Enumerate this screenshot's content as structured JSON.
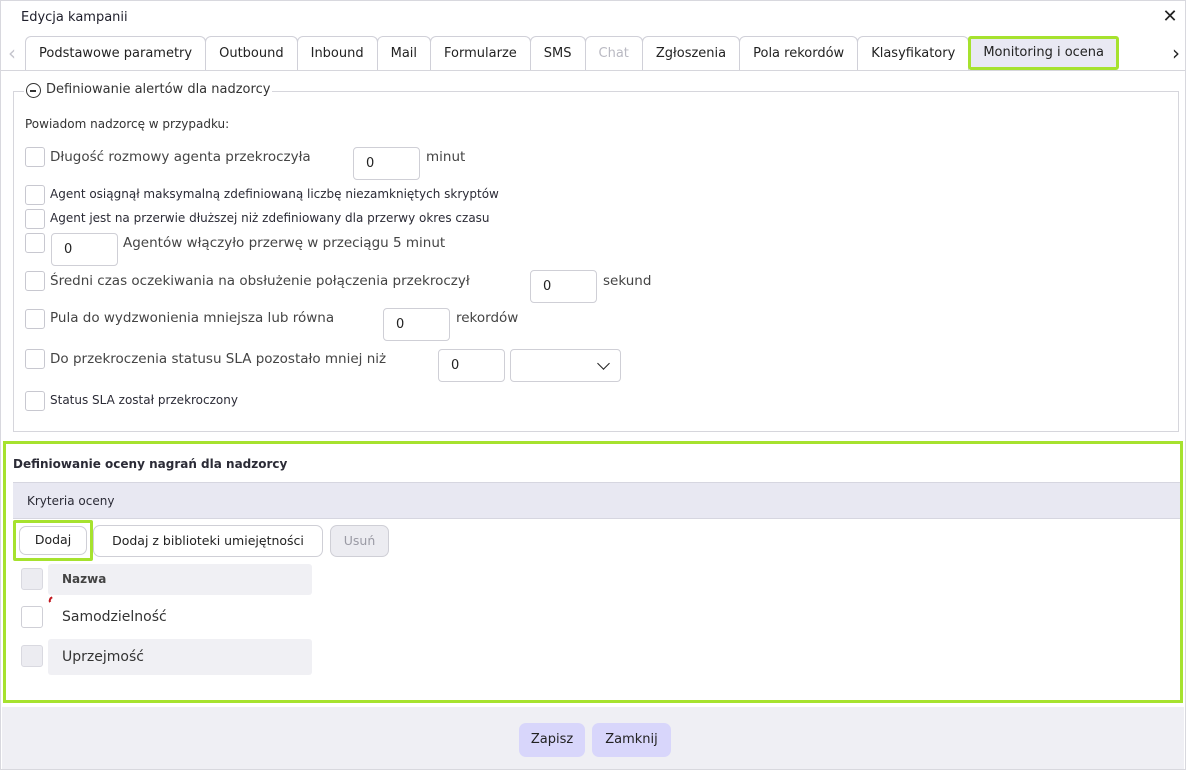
{
  "window": {
    "title": "Edycja kampanii"
  },
  "tabs": [
    {
      "label": "Podstawowe parametry",
      "state": "normal"
    },
    {
      "label": "Outbound",
      "state": "normal"
    },
    {
      "label": "Inbound",
      "state": "normal"
    },
    {
      "label": "Mail",
      "state": "normal"
    },
    {
      "label": "Formularze",
      "state": "normal"
    },
    {
      "label": "SMS",
      "state": "normal"
    },
    {
      "label": "Chat",
      "state": "disabled"
    },
    {
      "label": "Zgłoszenia",
      "state": "normal"
    },
    {
      "label": "Pola rekordów",
      "state": "normal"
    },
    {
      "label": "Klasyfikatory",
      "state": "normal"
    },
    {
      "label": "Monitoring i ocena",
      "state": "active"
    }
  ],
  "alerts": {
    "legend": "Definiowanie alertów dla nadzorcy",
    "intro": "Powiadom nadzorcę w przypadku:",
    "call_length": {
      "label": "Długość rozmowy agenta przekroczyła",
      "value": "0",
      "unit": "minut"
    },
    "max_scripts": {
      "label": "Agent osiągnął maksymalną zdefiniowaną liczbę niezamkniętych skryptów"
    },
    "long_break": {
      "label": "Agent jest na przerwie dłuższej niż zdefiniowany dla przerwy okres czasu"
    },
    "break_count": {
      "value": "0",
      "label": "Agentów włączyło przerwę w przeciągu 5 minut"
    },
    "avg_wait": {
      "label": "Średni czas oczekiwania na obsłużenie połączenia przekroczył",
      "value": "0",
      "unit": "sekund"
    },
    "pool": {
      "label": "Pula do wydzwonienia mniejsza lub równa",
      "value": "0",
      "unit": "rekordów"
    },
    "sla_left": {
      "label": "Do przekroczenia statusu SLA pozostało mniej niż",
      "value": "0",
      "select_value": ""
    },
    "sla_exceeded": {
      "label": "Status SLA został przekroczony"
    }
  },
  "rating": {
    "title": "Definiowanie oceny nagrań dla nadzorcy",
    "criteria_header": "Kryteria oceny",
    "buttons": {
      "add": "Dodaj",
      "add_library": "Dodaj z biblioteki umiejętności",
      "remove": "Usuń"
    },
    "table": {
      "column": "Nazwa",
      "rows": [
        {
          "name": "Samodzielność"
        },
        {
          "name": "Uprzejmość"
        }
      ]
    }
  },
  "footer": {
    "save": "Zapisz",
    "close": "Zamknij"
  },
  "colors": {
    "highlight": "#a6e22e",
    "primary_button": "#d8d6fb",
    "header_bar": "#e8e8f2"
  }
}
